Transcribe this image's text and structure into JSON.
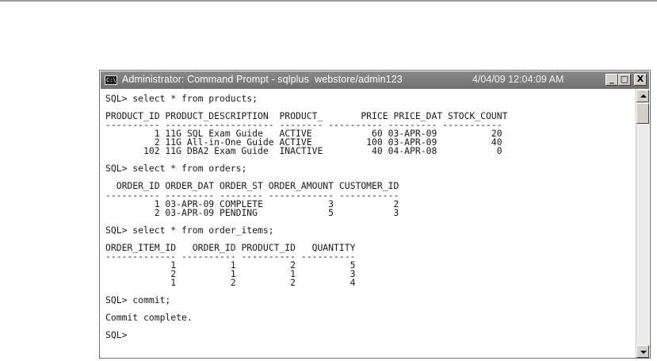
{
  "window": {
    "title": "Administrator: Command Prompt - sqlplus  webstore/admin123",
    "datetime": "4/04/09 12:04:09 AM",
    "icon_label": "C:\\",
    "buttons": {
      "minimize": "_",
      "maximize": "□",
      "close": "X"
    }
  },
  "console": {
    "lines": [
      "SQL> select * from products;",
      "",
      "PRODUCT_ID PRODUCT_DESCRIPTION  PRODUCT_       PRICE PRICE_DAT STOCK_COUNT",
      "---------- -------------------- -------- ---------- --------- -----------",
      "         1 11G SQL Exam Guide   ACTIVE           60 03-APR-09          20",
      "         2 11G All-in-One Guide ACTIVE          100 03-APR-09          40",
      "       102 11G DBA2 Exam Guide  INACTIVE         40 04-APR-08           0",
      "",
      "SQL> select * from orders;",
      "",
      "  ORDER_ID ORDER_DAT ORDER_ST ORDER_AMOUNT CUSTOMER_ID",
      "---------- --------- -------- ------------ -----------",
      "         1 03-APR-09 COMPLETE            3           2",
      "         2 03-APR-09 PENDING             5           3",
      "",
      "SQL> select * from order_items;",
      "",
      "ORDER_ITEM_ID   ORDER_ID PRODUCT_ID   QUANTITY",
      "------------- ---------- ---------- ----------",
      "            1          1          2          5",
      "            2          1          1          3",
      "            1          2          2          4",
      "",
      "SQL> commit;",
      "",
      "Commit complete.",
      "",
      "SQL>"
    ]
  },
  "colors": {
    "titlebar": "#7a7a7a",
    "console_background": "#ffffff",
    "console_text": "#1a1a1a"
  }
}
